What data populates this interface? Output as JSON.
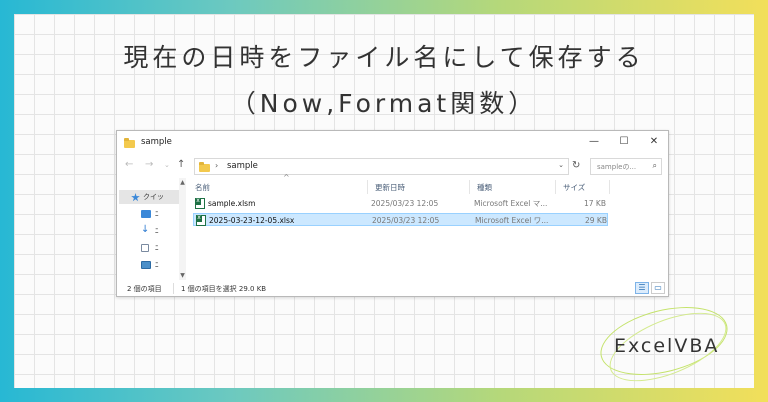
{
  "heading": {
    "line1": "現在の日時をファイル名にして保存する",
    "line2": "（Now,Format関数）"
  },
  "explorer": {
    "window_title": "sample",
    "controls": {
      "minimize": "—",
      "maximize": "☐",
      "close": "✕"
    },
    "nav": {
      "back": "←",
      "forward": "→",
      "dropdown": "⌄",
      "up": "↑"
    },
    "address": {
      "separator": "›",
      "path": "sample",
      "dropdown": "⌄",
      "refresh": "↻"
    },
    "search": {
      "placeholder": "sampleの...",
      "icon": "⌕"
    },
    "sidebar": {
      "items": [
        {
          "label": "クイッ",
          "icon": "star-icon"
        },
        {
          "label": "ﾆ",
          "icon": "desktop-icon"
        },
        {
          "label": "ﾆ",
          "icon": "download-icon"
        },
        {
          "label": "ﾆ",
          "icon": "document-icon"
        },
        {
          "label": "ﾆ",
          "icon": "picture-icon"
        }
      ],
      "scroll_up": "▲",
      "scroll_down": "▼"
    },
    "columns": {
      "name": "名前",
      "modified": "更新日時",
      "type": "種類",
      "size": "サイズ",
      "sort_indicator": "^"
    },
    "files": [
      {
        "name": "sample.xlsm",
        "modified": "2025/03/23 12:05",
        "type": "Microsoft Excel マ...",
        "size": "17 KB",
        "selected": false
      },
      {
        "name": "2025-03-23-12-05.xlsx",
        "modified": "2025/03/23 12:05",
        "type": "Microsoft Excel ワ...",
        "size": "29 KB",
        "selected": true
      }
    ],
    "status": {
      "item_count": "2 個の項目",
      "selection": "1 個の項目を選択  29.0 KB"
    },
    "view_buttons": {
      "details": "☰",
      "tiles": "▭"
    }
  },
  "brand": {
    "label": "ExcelVBA"
  },
  "colors": {
    "frame_left": "#27b8d4",
    "frame_right": "#f2df5a",
    "selection_bg": "#cce8ff",
    "excel_green": "#1e7145",
    "brand_ring": "#c4e36a"
  }
}
